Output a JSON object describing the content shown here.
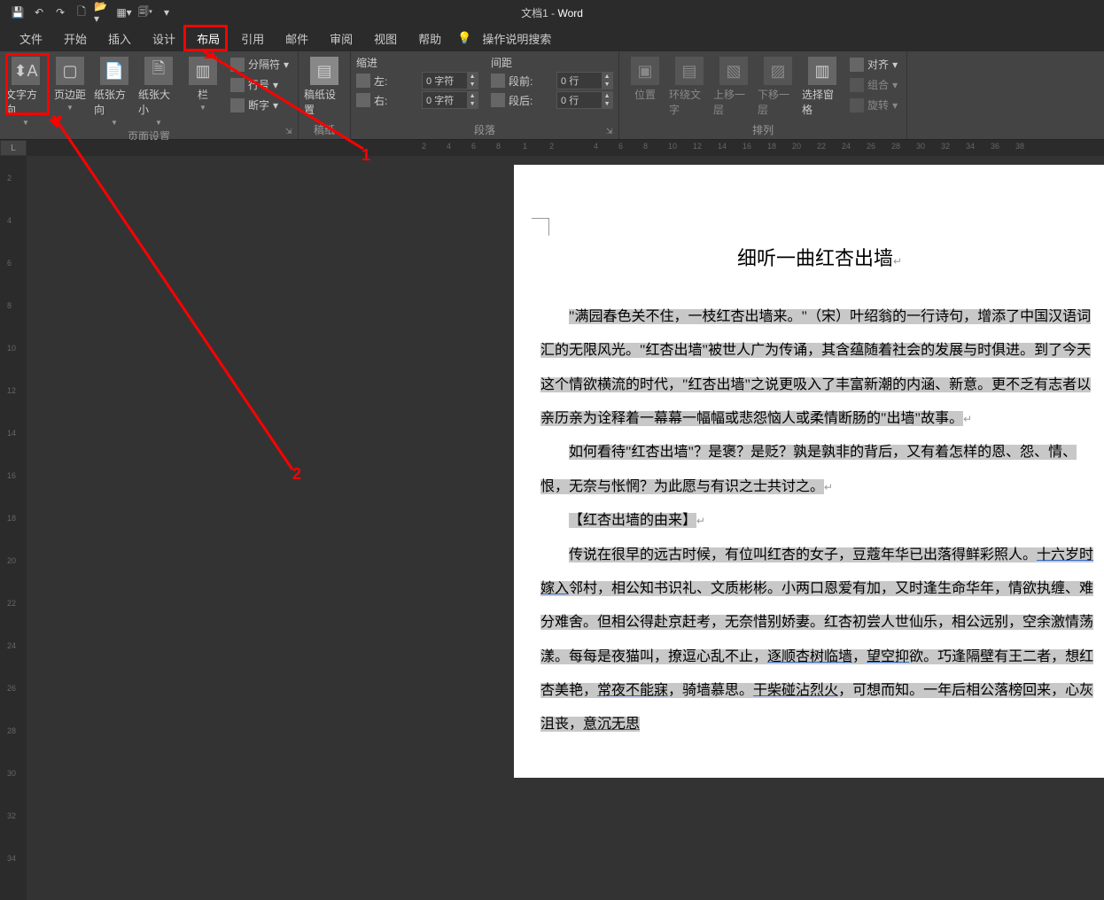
{
  "title": {
    "doc": "文档1",
    "sep": " - ",
    "app": "Word"
  },
  "menu": {
    "file": "文件",
    "home": "开始",
    "insert": "插入",
    "design": "设计",
    "layout": "布局",
    "references": "引用",
    "mailings": "邮件",
    "review": "审阅",
    "view": "视图",
    "help": "帮助",
    "search": "操作说明搜索"
  },
  "ribbon": {
    "page_setup": {
      "text_direction": "文字方向",
      "margins": "页边距",
      "orientation": "纸张方向",
      "size": "纸张大小",
      "columns": "栏",
      "breaks": "分隔符",
      "line_numbers": "行号",
      "hyphenation": "断字",
      "group": "页面设置"
    },
    "manuscript": {
      "settings": "稿纸设置",
      "group": "稿纸"
    },
    "paragraph": {
      "indent": "缩进",
      "spacing": "间距",
      "left": "左:",
      "right": "右:",
      "before": "段前:",
      "after": "段后:",
      "zero_char": "0 字符",
      "zero_line": "0 行",
      "group": "段落"
    },
    "arrange": {
      "position": "位置",
      "wrap": "环绕文字",
      "forward": "上移一层",
      "backward": "下移一层",
      "selection_pane": "选择窗格",
      "align": "对齐",
      "group_objects": "组合",
      "rotate": "旋转",
      "group": "排列"
    }
  },
  "ruler_corner": "L",
  "hruler_ticks": [
    8,
    6,
    4,
    2,
    1,
    2,
    4,
    6,
    8,
    10,
    12,
    14,
    16,
    18,
    20,
    22,
    24,
    26,
    28,
    30,
    32,
    34,
    36,
    38
  ],
  "vruler_ticks": [
    2,
    4,
    6,
    8,
    10,
    12,
    14,
    16,
    18,
    20,
    22,
    24,
    26,
    28,
    30,
    32,
    34
  ],
  "annotations": {
    "one": "1",
    "two": "2"
  },
  "document": {
    "title": "细听一曲红杏出墙",
    "p1a": "\"满园春色关不住，一枝红杏出墙来。\"（宋）叶绍翁的一行诗句，增添了中国汉语词汇的无限风光。\"红杏出墙\"被世人广为传诵，其含蕴随着社会的发展与时俱进。到了今天这个情欲横流的时代，\"红杏出墙\"之说更吸入了丰富新潮的内涵、新意。更不乏有志者以亲历亲为诠释着一幕幕一幅幅或悲怨恼人或柔情断肠的\"出墙\"故事。",
    "p2": "如何看待\"红杏出墙\"？是褒？是贬？孰是孰非的背后，又有着怎样的恩、怨、情、恨，无奈与怅惘？为此愿与有识之士共讨之。",
    "p3": "【红杏出墙的由来】",
    "p4a": "传说在很早的远古时候，有位叫红杏的女子，豆蔻年华已出落得鲜彩照人。",
    "p4_link1": "十六岁时嫁入",
    "p4b": "邻村，相公知书识礼、文质彬彬。小两口恩爱有加，又时逢生命华年，情欲执缠、难分难舍。但相公得赴京赶考，无奈惜别娇妻。红杏初尝人世仙乐，相公远别，空余激情荡漾。每每是夜猫叫，撩逗心乱不止，",
    "p4_link2": "逐顺杏树临墙",
    "p4c": "，",
    "p4_link3": "望空抑",
    "p4d": "欲。巧逢隔壁有王二者，想红杏美艳，",
    "p4_link4": "常夜不能寐",
    "p4e": "，骑墙慕思。",
    "p4_link5": "干柴碰沾烈火",
    "p4f": "，可想而知。一年后相公落榜回来，心灰沮丧，",
    "p4_link6": "意沉无思"
  }
}
